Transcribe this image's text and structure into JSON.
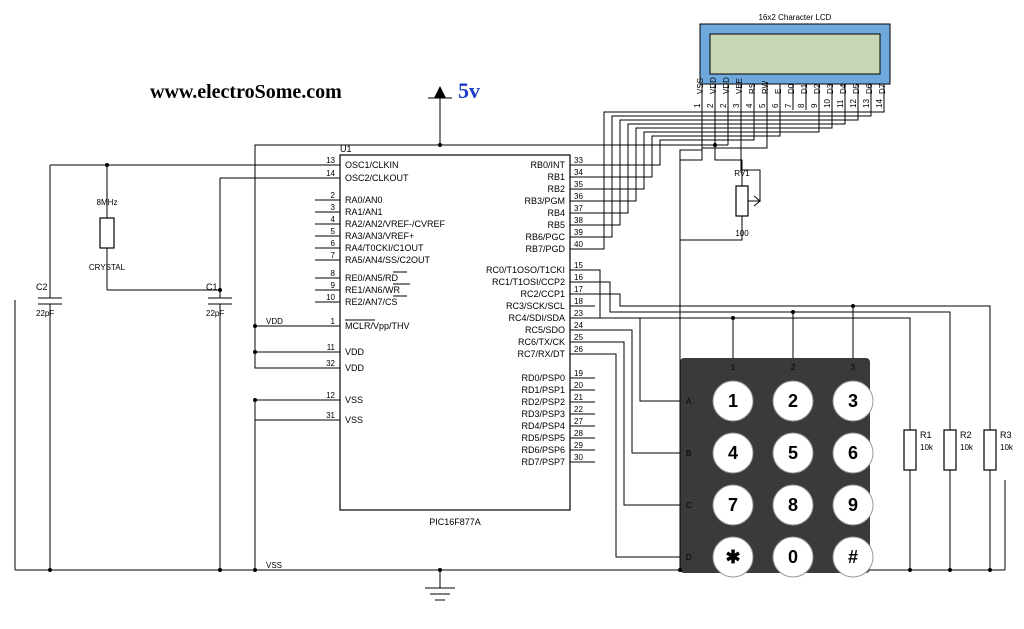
{
  "title": "www.electroSome.com",
  "supply_label": "5v",
  "lcd": {
    "title": "16x2 Character LCD",
    "pins": [
      "VSS",
      "VDD",
      "VDD",
      "VEE",
      "RS",
      "RW",
      "E",
      "D0",
      "D1",
      "D2",
      "D3",
      "D4",
      "D5",
      "D6",
      "D7"
    ],
    "nums": [
      "1",
      "2",
      "2",
      "3",
      "4",
      "5",
      "6",
      "7",
      "8",
      "9",
      "10",
      "11",
      "12",
      "13",
      "14"
    ]
  },
  "mcu": {
    "ref": "U1",
    "part": "PIC16F877A",
    "left": [
      {
        "n": "13",
        "t": "OSC1/CLKIN"
      },
      {
        "n": "14",
        "t": "OSC2/CLKOUT"
      },
      {
        "n": "2",
        "t": "RA0/AN0"
      },
      {
        "n": "3",
        "t": "RA1/AN1"
      },
      {
        "n": "4",
        "t": "RA2/AN2/VREF-/CVREF"
      },
      {
        "n": "5",
        "t": "RA3/AN3/VREF+"
      },
      {
        "n": "6",
        "t": "RA4/T0CKI/C1OUT"
      },
      {
        "n": "7",
        "t": "RA5/AN4/SS/C2OUT"
      },
      {
        "n": "8",
        "t": "RE0/AN5/RD"
      },
      {
        "n": "9",
        "t": "RE1/AN6/WR"
      },
      {
        "n": "10",
        "t": "RE2/AN7/CS"
      },
      {
        "n": "1",
        "t": "MCLR/Vpp/THV"
      },
      {
        "n": "11",
        "t": "VDD"
      },
      {
        "n": "32",
        "t": "VDD"
      },
      {
        "n": "12",
        "t": "VSS"
      },
      {
        "n": "31",
        "t": "VSS"
      }
    ],
    "right": [
      {
        "n": "33",
        "t": "RB0/INT"
      },
      {
        "n": "34",
        "t": "RB1"
      },
      {
        "n": "35",
        "t": "RB2"
      },
      {
        "n": "36",
        "t": "RB3/PGM"
      },
      {
        "n": "37",
        "t": "RB4"
      },
      {
        "n": "38",
        "t": "RB5"
      },
      {
        "n": "39",
        "t": "RB6/PGC"
      },
      {
        "n": "40",
        "t": "RB7/PGD"
      },
      {
        "n": "15",
        "t": "RC0/T1OSO/T1CKI"
      },
      {
        "n": "16",
        "t": "RC1/T1OSI/CCP2"
      },
      {
        "n": "17",
        "t": "RC2/CCP1"
      },
      {
        "n": "18",
        "t": "RC3/SCK/SCL"
      },
      {
        "n": "23",
        "t": "RC4/SDI/SDA"
      },
      {
        "n": "24",
        "t": "RC5/SDO"
      },
      {
        "n": "25",
        "t": "RC6/TX/CK"
      },
      {
        "n": "26",
        "t": "RC7/RX/DT"
      },
      {
        "n": "19",
        "t": "RD0/PSP0"
      },
      {
        "n": "20",
        "t": "RD1/PSP1"
      },
      {
        "n": "21",
        "t": "RD2/PSP2"
      },
      {
        "n": "22",
        "t": "RD3/PSP3"
      },
      {
        "n": "27",
        "t": "RD4/PSP4"
      },
      {
        "n": "28",
        "t": "RD5/PSP5"
      },
      {
        "n": "29",
        "t": "RD6/PSP6"
      },
      {
        "n": "30",
        "t": "RD7/PSP7"
      }
    ]
  },
  "crystal": {
    "ref": "8MHz",
    "label": "CRYSTAL"
  },
  "caps": [
    {
      "ref": "C2",
      "val": "22pF"
    },
    {
      "ref": "C1",
      "val": "22pF"
    }
  ],
  "pot": {
    "ref": "RV1",
    "val": "100"
  },
  "resistors": [
    {
      "ref": "R1",
      "val": "10k"
    },
    {
      "ref": "R2",
      "val": "10k"
    },
    {
      "ref": "R3",
      "val": "10k"
    }
  ],
  "keypad": {
    "cols": [
      "1",
      "2",
      "3"
    ],
    "rows": [
      "A",
      "B",
      "C",
      "D"
    ],
    "keys": [
      [
        "1",
        "2",
        "3"
      ],
      [
        "4",
        "5",
        "6"
      ],
      [
        "7",
        "8",
        "9"
      ],
      [
        "✱",
        "0",
        "#"
      ]
    ]
  },
  "nets": {
    "vdd": "VDD",
    "vss": "VSS"
  }
}
